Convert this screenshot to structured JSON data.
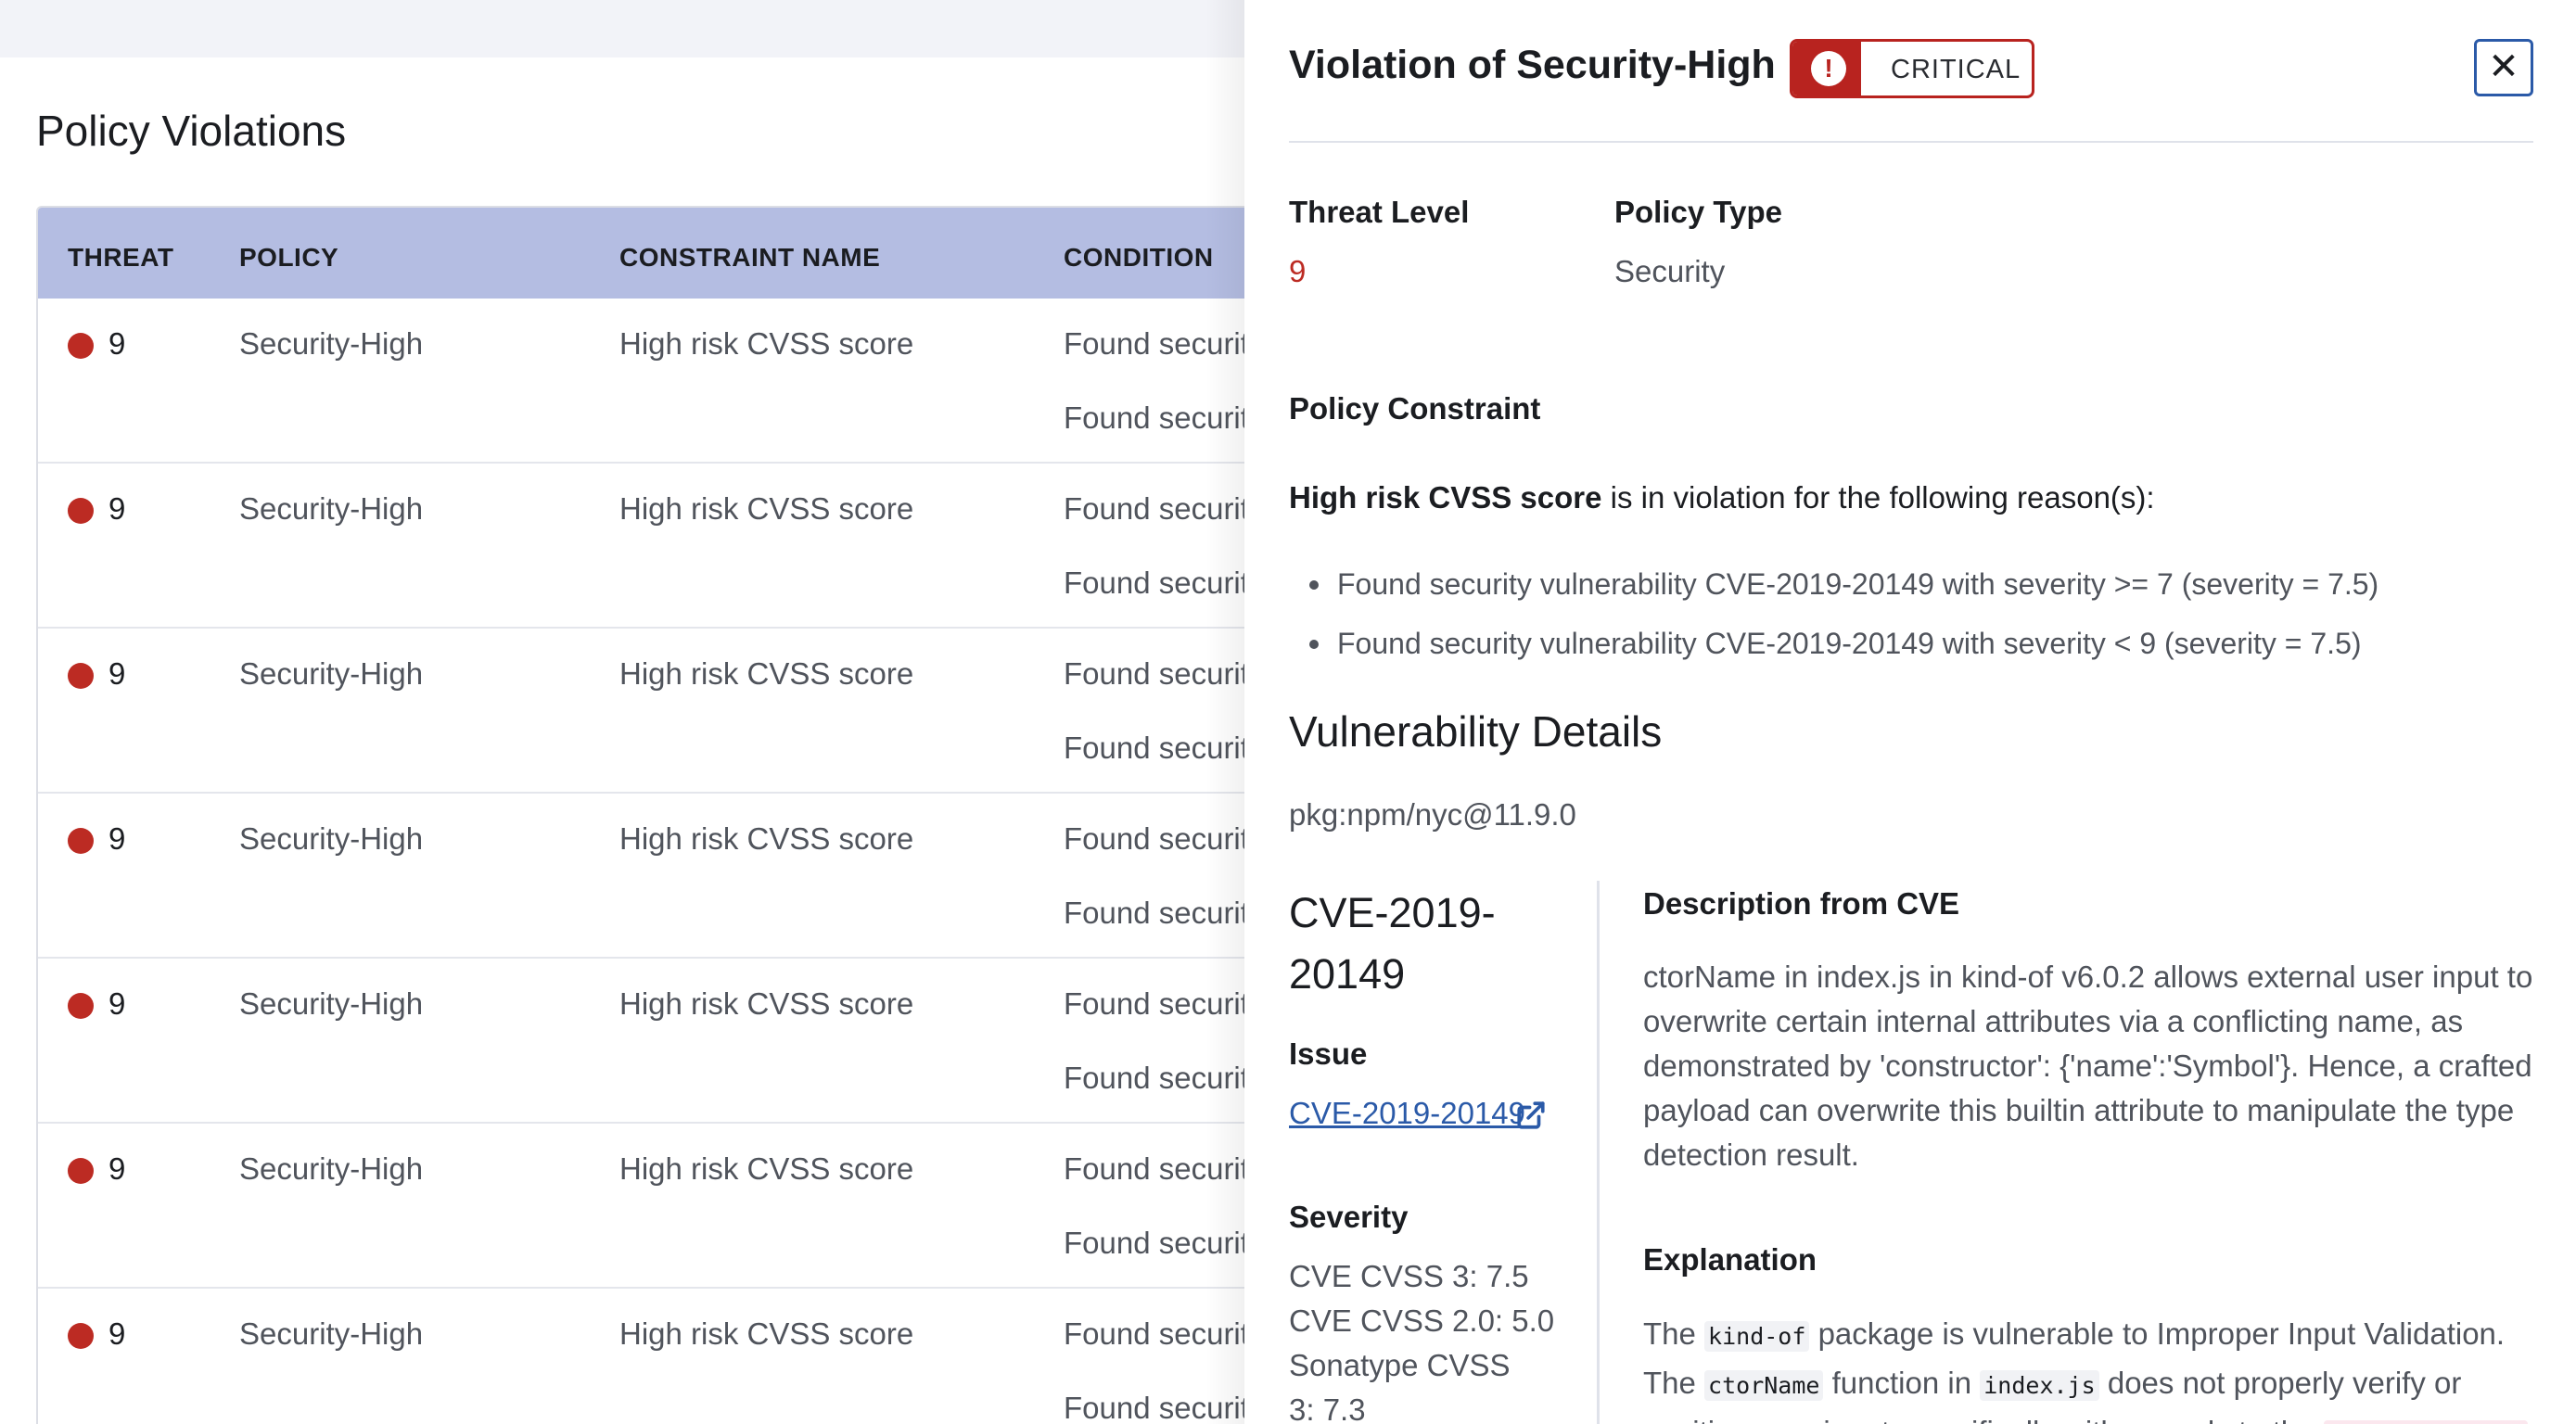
{
  "page": {
    "title": "Policy Violations"
  },
  "table": {
    "headers": {
      "threat": "THREAT",
      "policy": "POLICY",
      "constraint": "CONSTRAINT NAME",
      "condition": "CONDITION"
    },
    "rows": [
      {
        "threat": "9",
        "policy": "Security-High",
        "constraint": "High risk CVSS score",
        "condition_1": "Found securit",
        "condition_2": "Found securit"
      },
      {
        "threat": "9",
        "policy": "Security-High",
        "constraint": "High risk CVSS score",
        "condition_1": "Found securit",
        "condition_2": "Found securit"
      },
      {
        "threat": "9",
        "policy": "Security-High",
        "constraint": "High risk CVSS score",
        "condition_1": "Found securit",
        "condition_2": "Found securit"
      },
      {
        "threat": "9",
        "policy": "Security-High",
        "constraint": "High risk CVSS score",
        "condition_1": "Found securit",
        "condition_2": "Found securit"
      },
      {
        "threat": "9",
        "policy": "Security-High",
        "constraint": "High risk CVSS score",
        "condition_1": "Found securit",
        "condition_2": "Found securit"
      },
      {
        "threat": "9",
        "policy": "Security-High",
        "constraint": "High risk CVSS score",
        "condition_1": "Found securit",
        "condition_2": "Found securit"
      },
      {
        "threat": "9",
        "policy": "Security-High",
        "constraint": "High risk CVSS score",
        "condition_1": "Found securit",
        "condition_2": "Found securit"
      }
    ]
  },
  "drawer": {
    "title": "Violation of Security-High",
    "badge": {
      "label": "CRITICAL",
      "icon": "exclamation-circle-icon",
      "color": "#b8231f"
    },
    "close_icon": "close-icon",
    "threat_level": {
      "label": "Threat Level",
      "value": "9"
    },
    "policy_type": {
      "label": "Policy Type",
      "value": "Security"
    },
    "policy_constraint": {
      "label": "Policy Constraint",
      "constraint_name": "High risk CVSS score",
      "reason_suffix": " is in violation for the following reason(s):",
      "reasons": [
        "Found security vulnerability CVE-2019-20149 with severity >= 7 (severity = 7.5)",
        "Found security vulnerability CVE-2019-20149 with severity < 9 (severity = 7.5)"
      ]
    },
    "vulnerability": {
      "heading": "Vulnerability Details",
      "package": "pkg:npm/nyc@11.9.0",
      "cve_title_line1": "CVE-2019-",
      "cve_title_line2": "20149",
      "issue_label": "Issue",
      "issue_link": "CVE-2019-20149",
      "severity_label": "Severity",
      "severity_lines": [
        "CVE CVSS 3:  7.5",
        "CVE CVSS 2.0:  5.0",
        "Sonatype CVSS",
        "3:  7.3"
      ],
      "description_label": "Description from CVE",
      "description": "ctorName in index.js in kind-of v6.0.2 allows external user input to overwrite certain internal attributes via a conflicting name, as demonstrated by 'constructor': {'name':'Symbol'}. Hence, a crafted payload can overwrite this builtin attribute to manipulate the type detection result.",
      "explanation_label": "Explanation",
      "explanation": {
        "t1": "The ",
        "c1": "kind-of",
        "t2": " package is vulnerable to Improper Input Validation. The ",
        "c2": "ctorName",
        "t3": " function in ",
        "c3": "index.js",
        "t4": " does not properly verify or sanitize user input, specifically with regards to the "
      }
    }
  },
  "colors": {
    "header_bg": "#b4bde2",
    "threat_red": "#bc2b23",
    "link_blue": "#2b5aa8"
  }
}
